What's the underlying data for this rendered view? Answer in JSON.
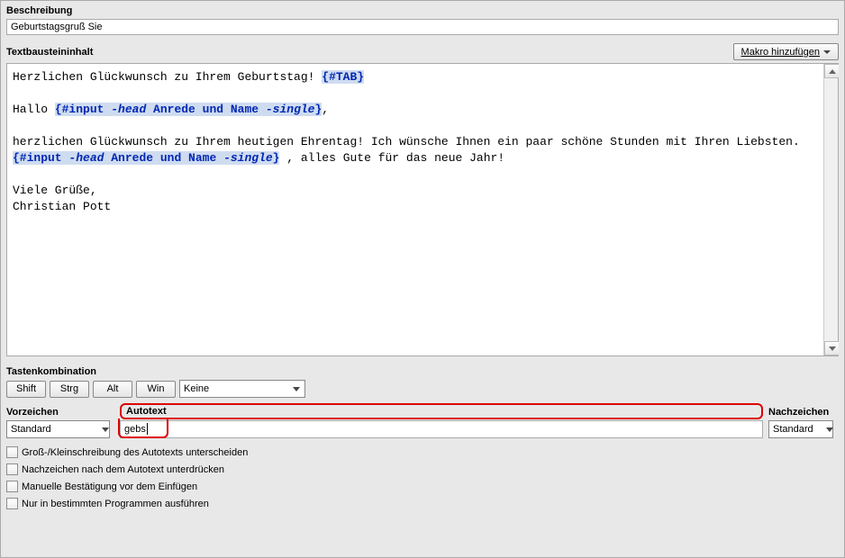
{
  "description": {
    "label": "Beschreibung",
    "value": "Geburtstagsgruß Sie"
  },
  "content": {
    "label": "Textbausteininhalt",
    "macro_button": "Makro hinzufügen",
    "text": {
      "line1_pre": "Herzlichen Glückwunsch zu Ihrem Geburtstag! ",
      "tab_macro": "{#TAB}",
      "line3_pre": "Hallo ",
      "input_open": "{#input ",
      "head_flag": "-head",
      "head_arg": " Anrede und Name ",
      "single_flag": "-single",
      "input_close": "}",
      "line3_post": ",",
      "line5": "herzlichen Glückwunsch zu Ihrem heutigen Ehrentag! Ich wünsche Ihnen ein paar schöne Stunden mit Ihren Liebsten.",
      "line6_post": " , alles Gute für das neue Jahr!",
      "line8": "Viele Grüße,",
      "line9": "Christian Pott"
    }
  },
  "hotkey": {
    "label": "Tastenkombination",
    "shift": "Shift",
    "ctrl": "Strg",
    "alt": "Alt",
    "win": "Win",
    "none": "Keine"
  },
  "autotext_row": {
    "prefix_label": "Vorzeichen",
    "autotext_label": "Autotext",
    "suffix_label": "Nachzeichen",
    "standard": "Standard",
    "autotext_value": "gebs"
  },
  "options": {
    "case_sensitive": "Groß-/Kleinschreibung des Autotexts unterscheiden",
    "suppress_suffix": "Nachzeichen nach dem Autotext unterdrücken",
    "manual_confirm": "Manuelle Bestätigung vor dem Einfügen",
    "only_programs": "Nur in bestimmten Programmen ausführen"
  }
}
